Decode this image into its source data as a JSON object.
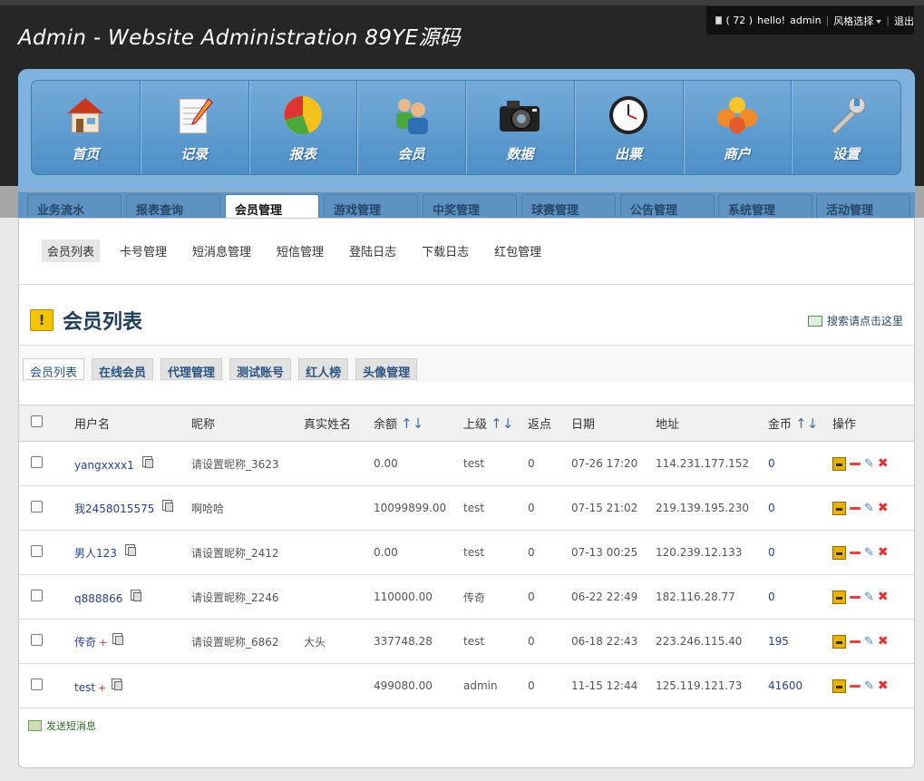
{
  "header": {
    "title": "Admin - Website Administration 89YE源码",
    "mail_count": "( 72 )",
    "greeting": "hello!",
    "username": "admin",
    "style_select": "风格选择",
    "logout": "退出"
  },
  "nav": [
    {
      "label": "首页",
      "icon": "home-icon"
    },
    {
      "label": "记录",
      "icon": "notepad-icon"
    },
    {
      "label": "报表",
      "icon": "pie-chart-icon"
    },
    {
      "label": "会员",
      "icon": "users-icon"
    },
    {
      "label": "数据",
      "icon": "camera-icon"
    },
    {
      "label": "出票",
      "icon": "clock-icon"
    },
    {
      "label": "商户",
      "icon": "merchant-icon"
    },
    {
      "label": "设置",
      "icon": "wrench-icon"
    }
  ],
  "tabs": [
    "业务流水",
    "报表查询",
    "会员管理",
    "游戏管理",
    "中奖管理",
    "球赛管理",
    "公告管理",
    "系统管理",
    "活动管理"
  ],
  "active_tab": 2,
  "subnav": [
    "会员列表",
    "卡号管理",
    "短消息管理",
    "短信管理",
    "登陆日志",
    "下载日志",
    "红包管理"
  ],
  "page": {
    "title": "会员列表",
    "search_link": "搜索请点击这里"
  },
  "subtabs": [
    "会员列表",
    "在线会员",
    "代理管理",
    "测试账号",
    "红人榜",
    "头像管理"
  ],
  "table": {
    "headers": {
      "username": "用户名",
      "nickname": "昵称",
      "realname": "真实姓名",
      "balance": "余额",
      "parent": "上级",
      "rebate": "返点",
      "date": "日期",
      "address": "地址",
      "coins": "金币",
      "ops": "操作",
      "sort_arrows": "↑↓"
    },
    "rows": [
      {
        "username": "yangxxxx1",
        "plus": "",
        "nickname": "请设置昵称_3623",
        "realname": "",
        "balance": "0.00",
        "parent": "test",
        "rebate": "0",
        "date": "07-26 17:20",
        "address": "114.231.177.152",
        "coins": "0"
      },
      {
        "username": "我2458015575",
        "plus": "",
        "nickname": "啊哈哈",
        "realname": "",
        "balance": "10099899.00",
        "parent": "test",
        "rebate": "0",
        "date": "07-15 21:02",
        "address": "219.139.195.230",
        "coins": "0"
      },
      {
        "username": "男人123",
        "plus": "",
        "nickname": "请设置昵称_2412",
        "realname": "",
        "balance": "0.00",
        "parent": "test",
        "rebate": "0",
        "date": "07-13 00:25",
        "address": "120.239.12.133",
        "coins": "0"
      },
      {
        "username": "q888866",
        "plus": "",
        "nickname": "请设置昵称_2246",
        "realname": "",
        "balance": "110000.00",
        "parent": "传奇",
        "rebate": "0",
        "date": "06-22 22:49",
        "address": "182.116.28.77",
        "coins": "0"
      },
      {
        "username": "传奇",
        "plus": "+",
        "nickname": "请设置昵称_6862",
        "realname": "大头",
        "balance": "337748.28",
        "parent": "test",
        "rebate": "0",
        "date": "06-18 22:43",
        "address": "223.246.115.40",
        "coins": "195"
      },
      {
        "username": "test",
        "plus": "+",
        "nickname": "",
        "realname": "",
        "balance": "499080.00",
        "parent": "admin",
        "rebate": "0",
        "date": "11-15 12:44",
        "address": "125.119.121.73",
        "coins": "41600"
      }
    ]
  },
  "footer": {
    "send_message": "发送短消息"
  }
}
